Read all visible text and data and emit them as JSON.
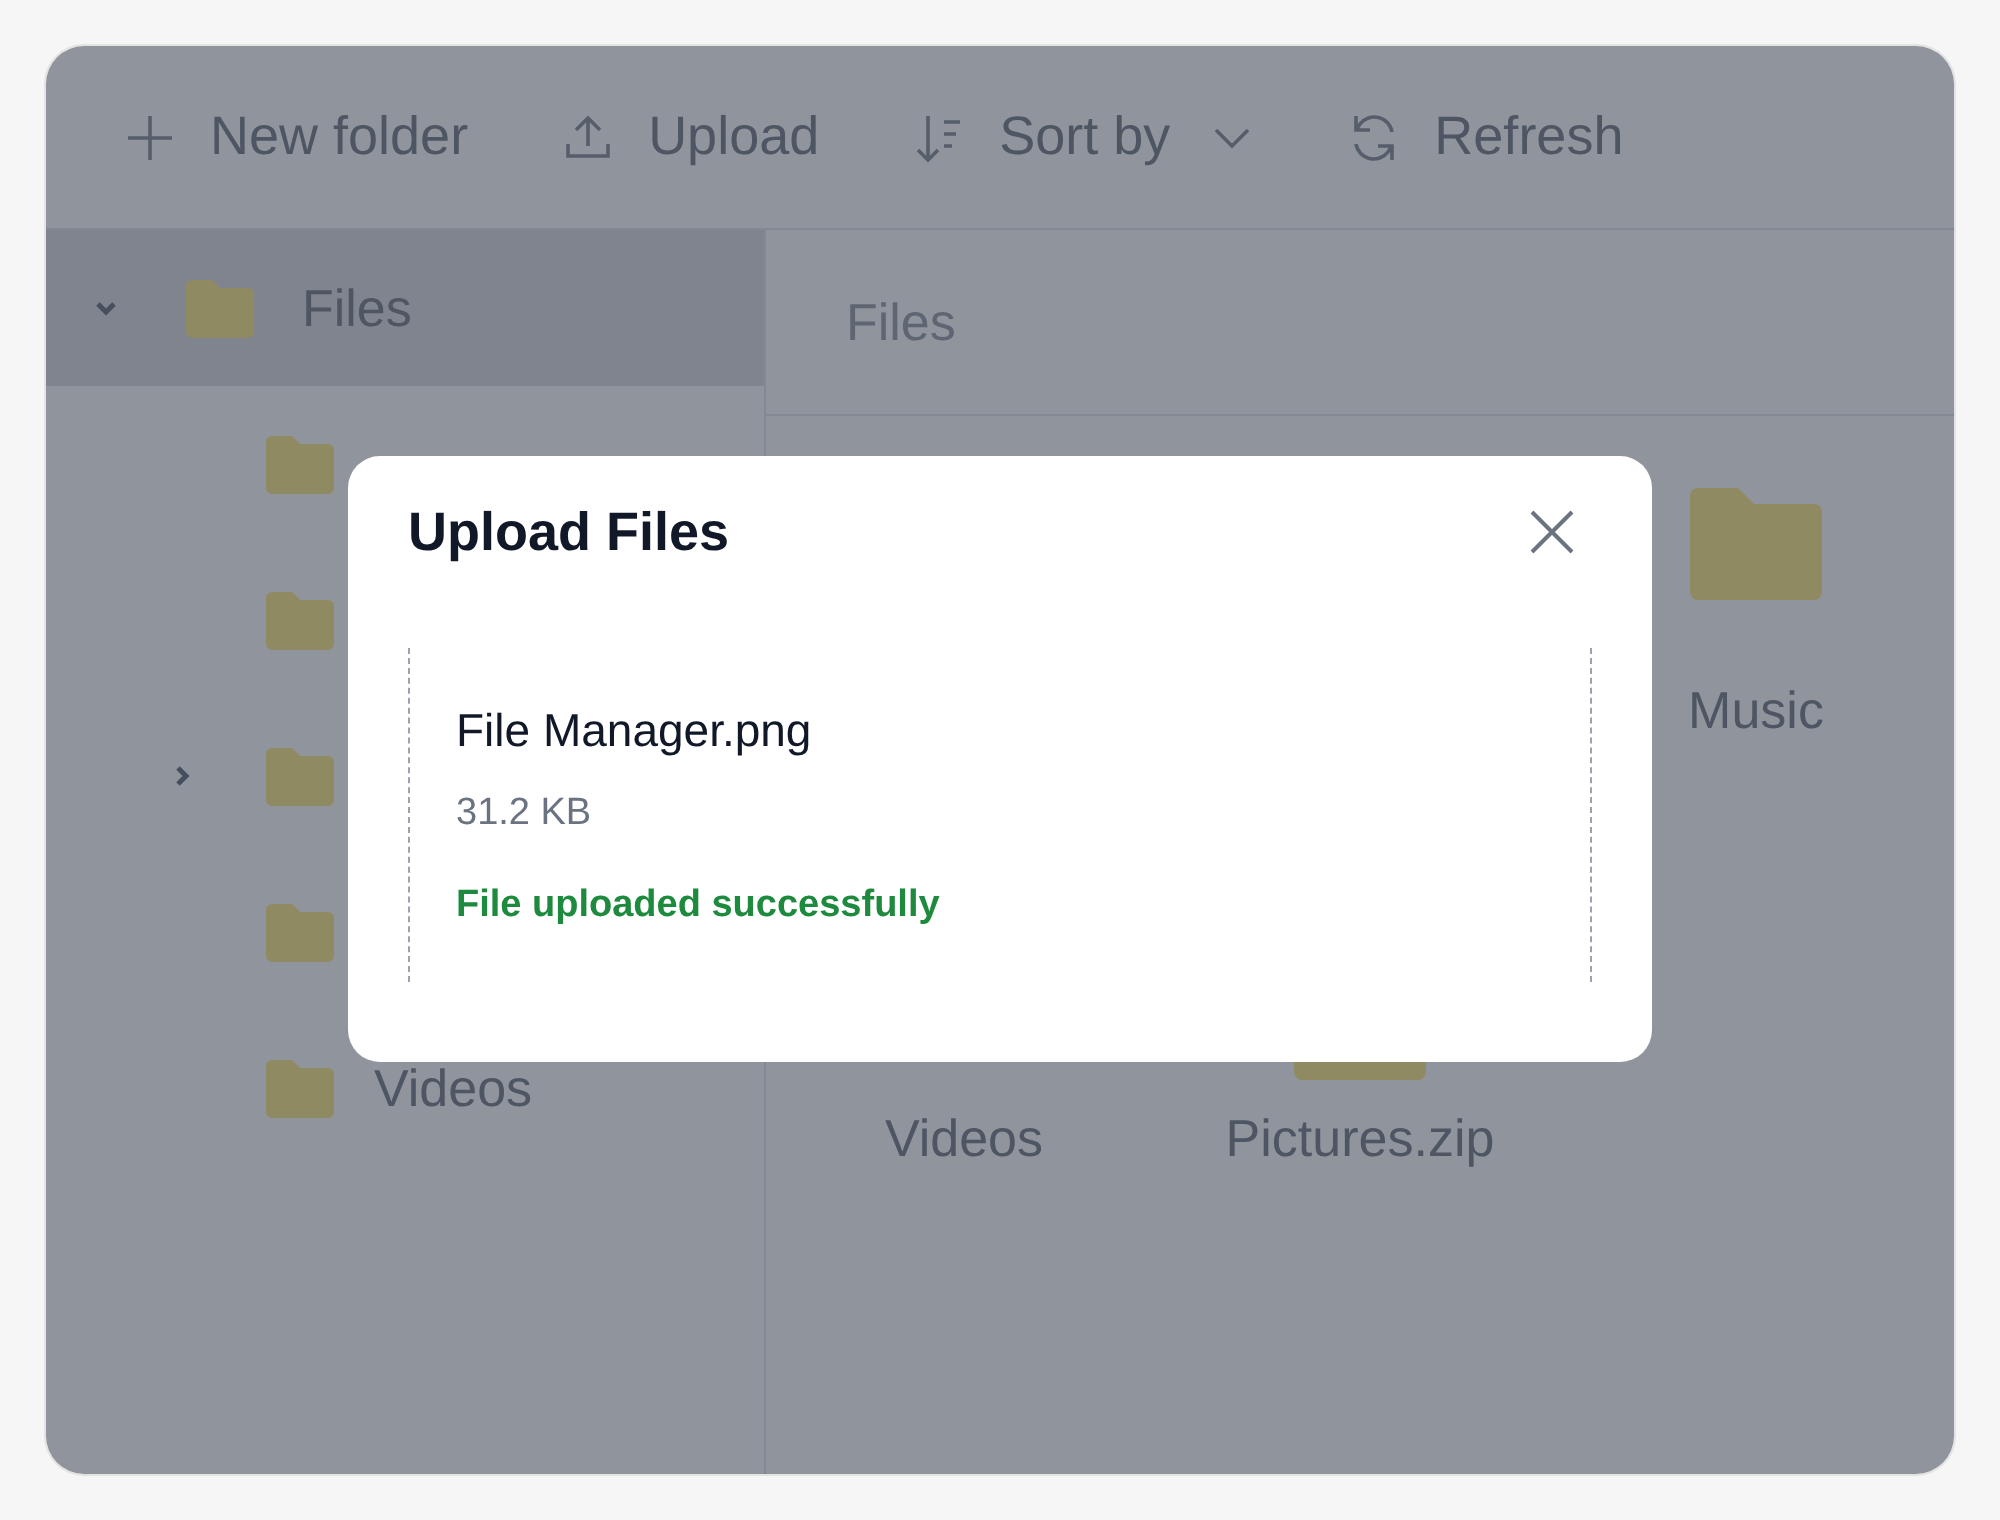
{
  "toolbar": [
    {
      "label": "New folder",
      "dropdown": false
    },
    {
      "label": "Upload",
      "dropdown": false
    },
    {
      "label": "Sort by",
      "dropdown": true
    },
    {
      "label": "Refresh",
      "dropdown": false
    }
  ],
  "tree": {
    "label": "Files",
    "expanded": true,
    "selected": true,
    "children": [
      {
        "kind": "leaf",
        "selected": false
      },
      {
        "kind": "leaf",
        "selected": false
      },
      {
        "kind": "branch",
        "expanded": false,
        "selected": false
      },
      {
        "kind": "leaf",
        "selected": false
      },
      {
        "kind": "leaf",
        "label": "Videos",
        "selected": false
      }
    ]
  },
  "breadcrumb": [
    "Files"
  ],
  "grid": [
    {
      "label": "Music",
      "kind": "folder"
    },
    {
      "label": "Videos",
      "kind": "folder"
    },
    {
      "label": "Pictures.zip",
      "kind": "zip"
    }
  ],
  "dialog": {
    "title": "Upload Files",
    "files": [
      {
        "name": "File Manager.png",
        "size": "31.2 KB",
        "status": "File uploaded successfully"
      }
    ]
  }
}
